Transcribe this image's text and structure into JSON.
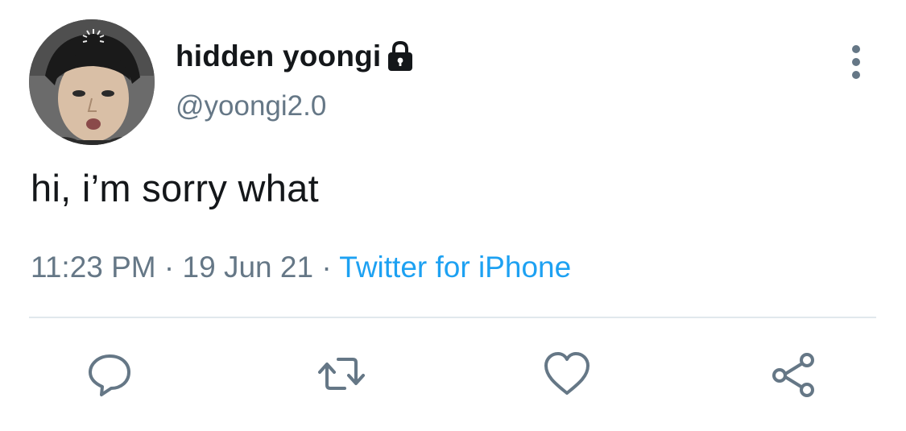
{
  "tweet": {
    "display_name": "hidden yoongi",
    "handle": "@yoongi2.0",
    "text": "hi, i’m sorry what",
    "time": "11:23 PM",
    "date": "19 Jun 21",
    "separator": "·",
    "source": "Twitter for iPhone"
  },
  "icons": {
    "account_status": "lock-icon",
    "more": "more-vertical-icon",
    "actions": [
      "reply-icon",
      "retweet-icon",
      "like-icon",
      "share-icon"
    ]
  },
  "colors": {
    "text_primary": "#14171a",
    "text_secondary": "#657786",
    "link": "#1da1f2",
    "icon": "#657786",
    "divider": "#e1e8ed"
  }
}
